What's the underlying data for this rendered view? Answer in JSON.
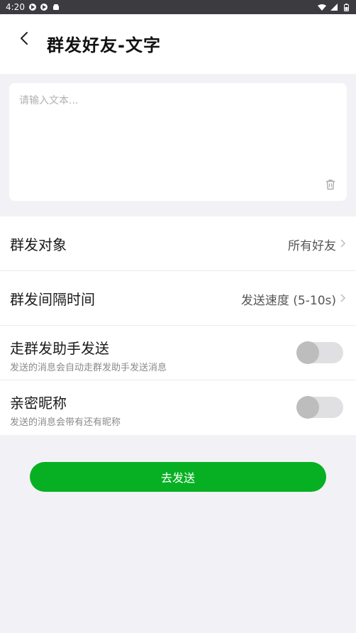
{
  "status_bar": {
    "time": "4:20"
  },
  "header": {
    "title": "群发好友-文字"
  },
  "message_input": {
    "placeholder": "请输入文本...",
    "value": ""
  },
  "settings": {
    "target": {
      "label": "群发对象",
      "value": "所有好友"
    },
    "interval": {
      "label": "群发间隔时间",
      "value": "发送速度 (5-10s)"
    },
    "assistant": {
      "label": "走群发助手发送",
      "description": "发送的消息会自动走群发助手发送消息",
      "enabled": false
    },
    "nickname": {
      "label": "亲密昵称",
      "description": "发送的消息会带有还有昵称",
      "enabled": false
    }
  },
  "actions": {
    "send_label": "去发送"
  },
  "colors": {
    "accent": "#07b023",
    "background": "#f2f2f6",
    "status_bar": "#3b3b40"
  },
  "icons": {
    "back": "chevron-left-icon",
    "trash": "trash-icon",
    "chevron": "chevron-right-icon"
  }
}
